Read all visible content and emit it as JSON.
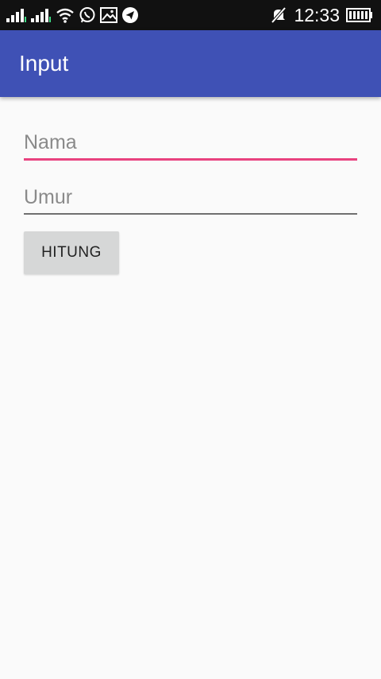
{
  "status_bar": {
    "time": "12:33",
    "icons": [
      "signal-1-icon",
      "signal-2-icon",
      "wifi-icon",
      "whatsapp-icon",
      "gallery-icon",
      "telegram-icon",
      "mute-icon",
      "battery-icon"
    ]
  },
  "app_bar": {
    "title": "Input"
  },
  "form": {
    "nama_placeholder": "Nama",
    "nama_value": "",
    "umur_placeholder": "Umur",
    "umur_value": "",
    "button_label": "HITUNG"
  },
  "colors": {
    "primary": "#3f51b5",
    "accent": "#e8427f",
    "status_bar": "#111111",
    "background": "#fafafa",
    "button": "#d6d7d7"
  }
}
